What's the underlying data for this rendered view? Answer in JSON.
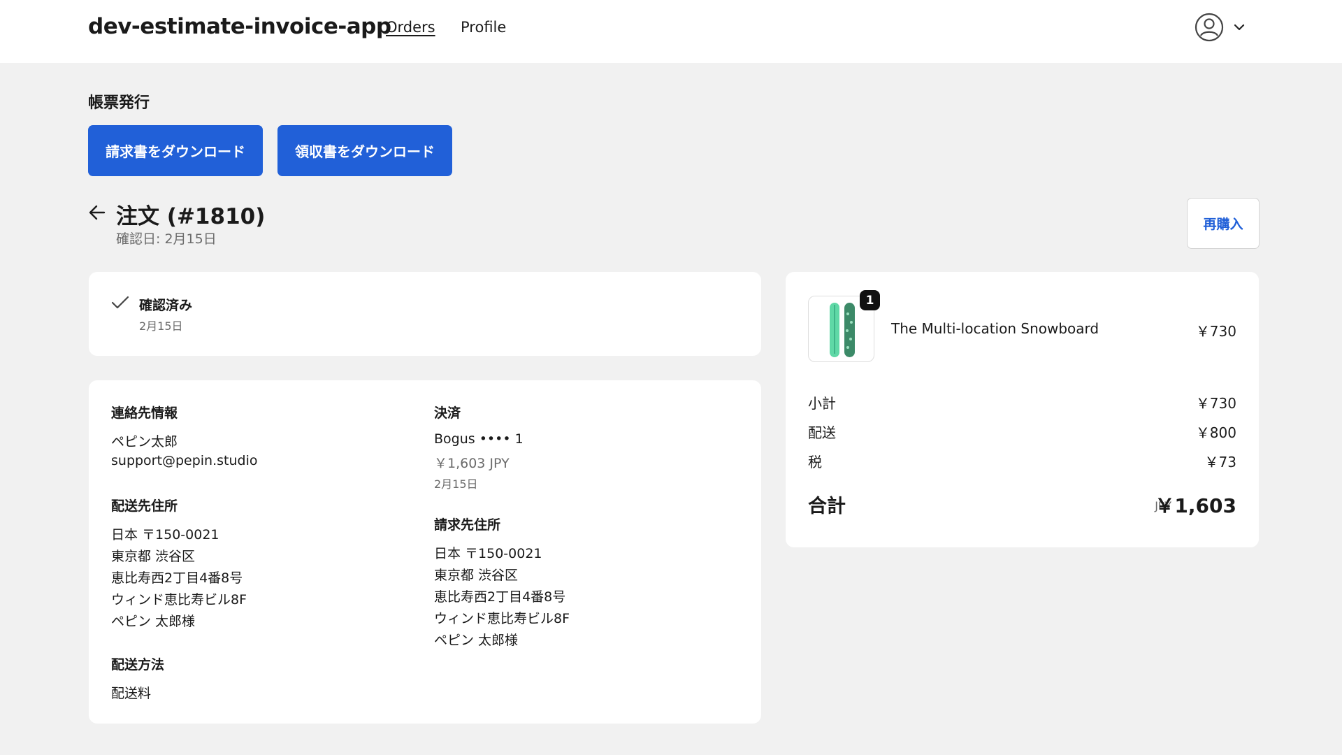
{
  "header": {
    "brand": "dev-estimate-invoice-app",
    "nav": {
      "orders": "Orders",
      "profile": "Profile"
    }
  },
  "documents": {
    "title": "帳票発行",
    "invoice_button": "請求書をダウンロード",
    "receipt_button": "領収書をダウンロード"
  },
  "order": {
    "title": "注文 (#1810)",
    "confirmed_date": "確認日: 2月15日",
    "reorder_button": "再購入"
  },
  "status": {
    "label": "確認済み",
    "date": "2月15日"
  },
  "contact": {
    "heading": "連絡先情報",
    "name": "ペピン太郎",
    "email": "support@pepin.studio"
  },
  "shipping_address": {
    "heading": "配送先住所",
    "lines": [
      "日本 〒150-0021",
      "東京都 渋谷区",
      "恵比寿西2丁目4番8号",
      "ウィンド恵比寿ビル8F",
      "ペピン 太郎様"
    ]
  },
  "shipping_method": {
    "heading": "配送方法",
    "value": "配送料"
  },
  "payment": {
    "heading": "決済",
    "method": "Bogus •••• 1",
    "amount": "￥1,603 JPY",
    "date": "2月15日"
  },
  "billing_address": {
    "heading": "請求先住所",
    "lines": [
      "日本 〒150-0021",
      "東京都 渋谷区",
      "恵比寿西2丁目4番8号",
      "ウィンド恵比寿ビル8F",
      "ペピン 太郎様"
    ]
  },
  "summary": {
    "item": {
      "quantity": "1",
      "name": "The Multi-location Snowboard",
      "price": "￥730"
    },
    "subtotal_label": "小計",
    "subtotal": "￥730",
    "shipping_label": "配送",
    "shipping": "￥800",
    "tax_label": "税",
    "tax": "￥73",
    "total_label": "合計",
    "currency": "JPY",
    "total": "￥1,603"
  },
  "colors": {
    "primary": "#2160d8",
    "background": "#f1f1f1",
    "card": "#ffffff",
    "snowboard_green": "#5fd8a6"
  },
  "icons": [
    "user-circle-icon",
    "chevron-down-icon",
    "arrow-left-icon",
    "checkmark-icon"
  ]
}
